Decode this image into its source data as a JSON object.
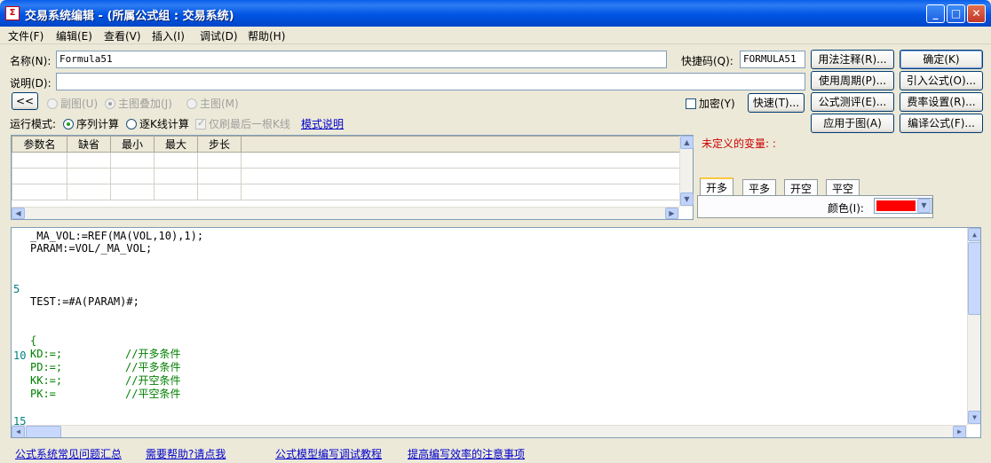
{
  "window": {
    "title": "交易系统编辑 - (所属公式组 : 交易系统)"
  },
  "menu": [
    "文件(F)",
    "编辑(E)",
    "查看(V)",
    "插入(I)",
    "调试(D)",
    "帮助(H)"
  ],
  "form": {
    "name_label": "名称(N):",
    "name_value": "Formula51",
    "shortcut_label": "快捷码(Q):",
    "shortcut_value": "FORMULA51",
    "desc_label": "说明(D):",
    "desc_value": "",
    "collapse_btn": "<<",
    "chart_modes": [
      "副图(U)",
      "主图叠加(J)",
      "主图(M)"
    ],
    "encrypt_label": "加密(Y)",
    "fast_btn": "快速(T)...",
    "run_mode_label": "运行模式:",
    "run_modes": [
      "序列计算",
      "逐K线计算"
    ],
    "last_bar_only": "仅刷最后一根K线",
    "mode_help_link": "模式说明"
  },
  "right_buttons": {
    "usage_note": "用法注释(R)...",
    "ok": "确定(K)",
    "period": "使用周期(P)...",
    "import": "引入公式(O)...",
    "test": "公式测评(E)...",
    "fee": "费率设置(R)...",
    "apply": "应用于图(A)",
    "compile": "编译公式(F)..."
  },
  "params_table": {
    "headers": [
      "参数名",
      "缺省",
      "最小",
      "最大",
      "步长"
    ],
    "rows": [
      [
        "",
        "",
        "",
        "",
        ""
      ],
      [
        "",
        "",
        "",
        "",
        ""
      ],
      [
        "",
        "",
        "",
        "",
        ""
      ],
      [
        "",
        "",
        "",
        "",
        ""
      ]
    ]
  },
  "undefined_vars_label": "未定义的变量: :",
  "signal_tabs": [
    "开多",
    "平多",
    "开空",
    "平空"
  ],
  "color_label": "颜色(I):",
  "colors": {
    "signal": "#FF0000",
    "undefined_vars": "#CC0000",
    "link": "#0000CC",
    "line_numbers": "#008080"
  },
  "editor": {
    "line_numbers": [
      "5",
      "10",
      "15"
    ],
    "lines": [
      "_MA_VOL:=REF(MA(VOL,10),1);",
      "PARAM:=VOL/_MA_VOL;",
      "TEST:=#A(PARAM)#;",
      "{",
      "KD:=;",
      "PD:=;",
      "KK:=;",
      "PK:="
    ],
    "comments": [
      "//开多条件",
      "//平多条件",
      "//开空条件",
      "//平空条件"
    ]
  },
  "footer_links": [
    "公式系统常见问题汇总",
    "需要帮助?请点我",
    "公式模型编写调试教程",
    "提高编写效率的注意事项"
  ]
}
